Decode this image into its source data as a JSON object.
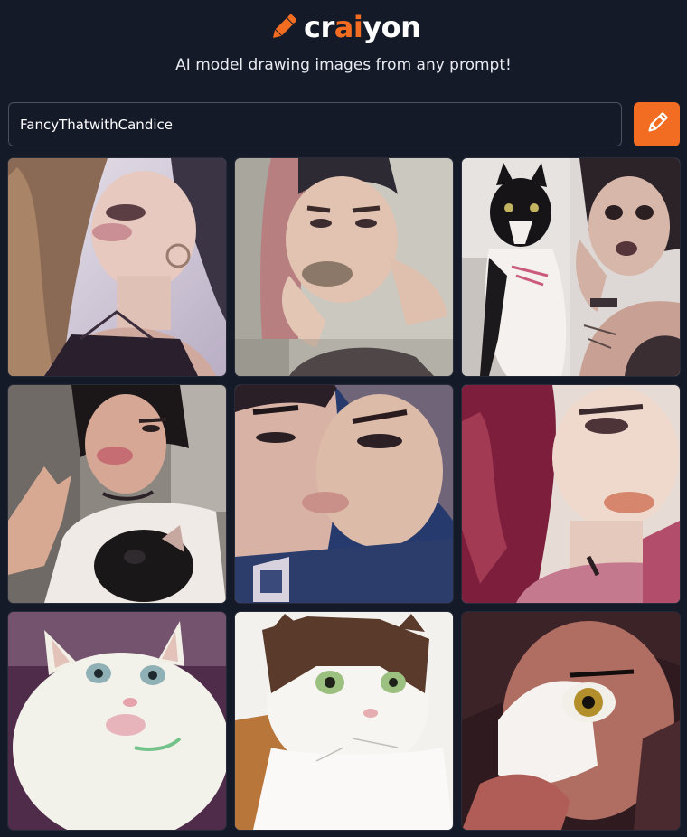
{
  "app": {
    "logo": {
      "text_prefix": "cr",
      "text_accent": "ai",
      "text_suffix": "yon",
      "icon": "pencil-icon",
      "accent_color": "#f26d21"
    },
    "tagline": "AI model drawing images from any prompt!"
  },
  "prompt": {
    "value": "FancyThatwithCandice",
    "draw_button_icon": "pencil-icon",
    "button_color": "#f26d21"
  },
  "results": {
    "images": [
      {
        "subject": "woman with long curly hair and hoop earring"
      },
      {
        "subject": "woman with hand on cheek pouting"
      },
      {
        "subject": "black and white cat beside woman"
      },
      {
        "subject": "woman making peace sign holding fluffy cat"
      },
      {
        "subject": "two women kissing close-up"
      },
      {
        "subject": "woman with red curly hair pouting"
      },
      {
        "subject": "white fluffy cat close-up"
      },
      {
        "subject": "calico cat with green eyes"
      },
      {
        "subject": "dark haired woman with painted face"
      }
    ]
  }
}
